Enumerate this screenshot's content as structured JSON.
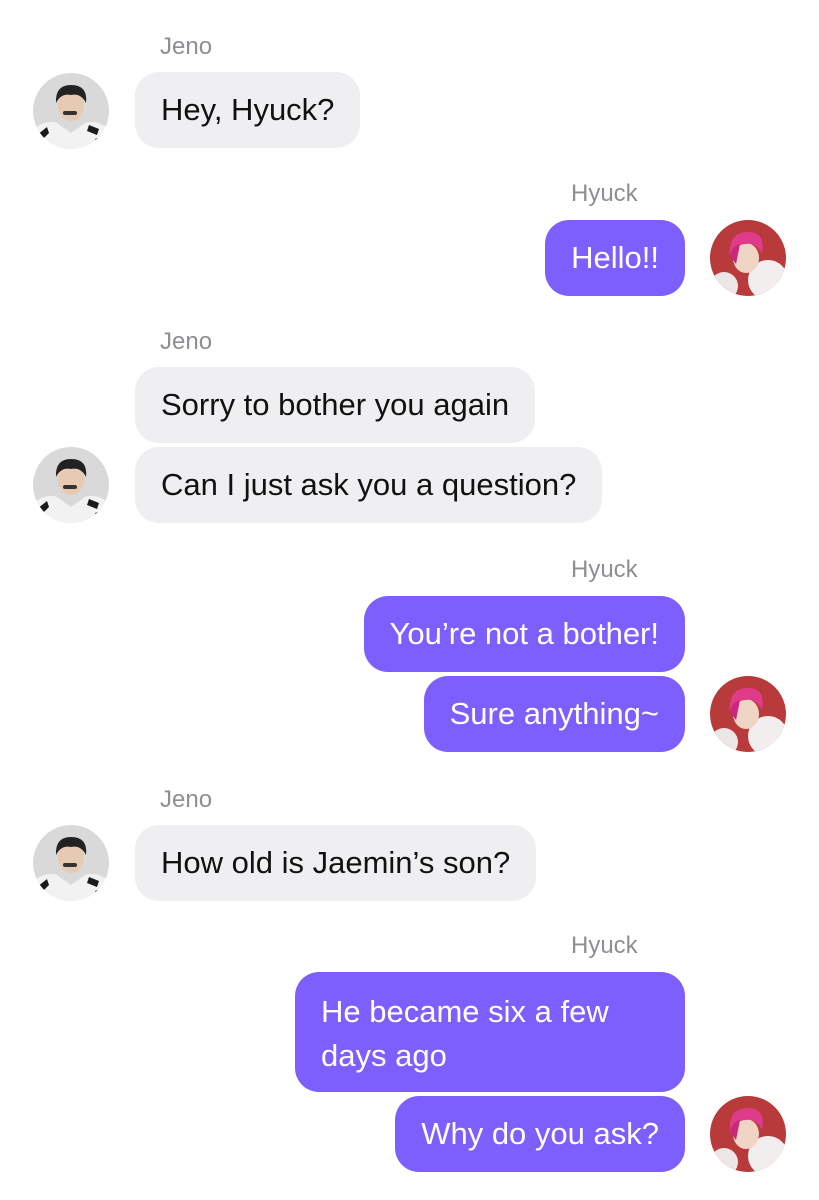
{
  "participants": {
    "jeno": {
      "name": "Jeno",
      "avatar": "jeno-avatar"
    },
    "hyuck": {
      "name": "Hyuck",
      "avatar": "hyuck-avatar"
    }
  },
  "colors": {
    "incoming_bubble": "#efeff2",
    "outgoing_bubble": "#7d5ffe",
    "sender_name": "#8e8e93"
  },
  "messages": {
    "m1": "Hey, Hyuck?",
    "m2": "Hello!!",
    "m3": "Sorry to bother you again",
    "m4": "Can I just ask you a question?",
    "m5": "You’re not a bother!",
    "m6": "Sure anything~",
    "m7": "How old is Jaemin’s son?",
    "m8": "He became six a few days ago",
    "m9": "Why do you ask?"
  }
}
